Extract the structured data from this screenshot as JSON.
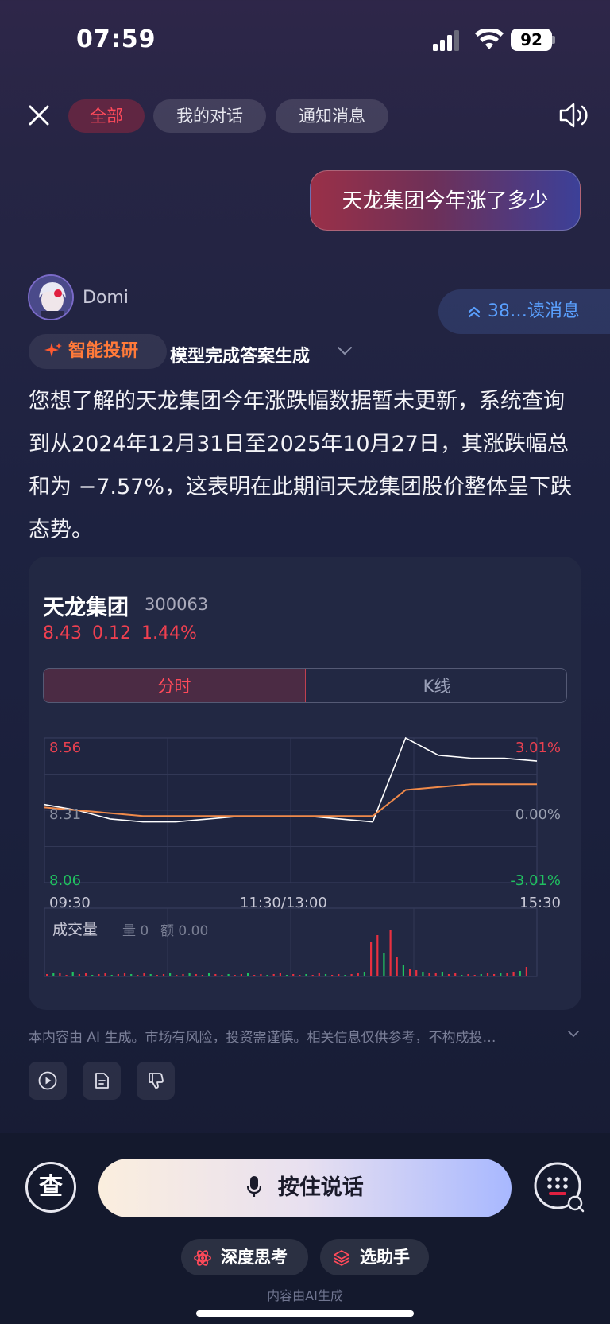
{
  "status_bar": {
    "time": "07:59",
    "battery": "92"
  },
  "header": {
    "tabs": [
      {
        "label": "全部",
        "active": true
      },
      {
        "label": "我的对话",
        "active": false
      },
      {
        "label": "通知消息",
        "active": false
      }
    ]
  },
  "conversation": {
    "user_message": "天龙集团今年涨了多少",
    "bot_name": "Domi",
    "unread_label": "38…读消息",
    "badge_label": "智能投研",
    "status_text": "模型完成答案生成",
    "answer_text": "您想了解的天龙集团今年涨跌幅数据暂未更新，系统查询到从2024年12月31日至2025年10月27日，其涨跌幅总和为 −7.57%，这表明在此期间天龙集团股价整体呈下跌态势。"
  },
  "stock_card": {
    "name": "天龙集团",
    "code": "300063",
    "quote": "8.43  0.12  1.44%",
    "tabs": [
      "分时",
      "K线"
    ],
    "chart_labels": {
      "price_high": "8.56",
      "price_mid": "8.31",
      "price_low": "8.06",
      "pct_high": "3.01%",
      "pct_mid": "0.00%",
      "pct_low": "-3.01%",
      "time_start": "09:30",
      "time_mid": "11:30/13:00",
      "time_end": "15:30",
      "volume_title": "成交量",
      "volume_qty": "量 0",
      "volume_amount": "额 0.00"
    }
  },
  "chart_data": {
    "type": "line",
    "title": "",
    "ylim": [
      8.06,
      8.56
    ],
    "x": [
      "09:30",
      "11:30/13:00",
      "15:30"
    ],
    "series": [
      {
        "values": [
          8.33,
          8.31,
          8.28,
          8.27,
          8.27,
          8.28,
          8.29,
          8.29,
          8.29,
          8.28,
          8.27,
          8.56,
          8.5,
          8.49,
          8.49,
          8.48
        ]
      },
      {
        "values": [
          8.32,
          8.31,
          8.3,
          8.29,
          8.29,
          8.29,
          8.29,
          8.29,
          8.29,
          8.29,
          8.29,
          8.38,
          8.39,
          8.4,
          8.4,
          8.4
        ]
      }
    ],
    "colors": {
      "price": "#ffffff",
      "average": "#f08a4a",
      "up": "#e83040",
      "down": "#20c060"
    }
  },
  "disclaimer": "本内容由 AI 生成。市场有风险，投资需谨慎。相关信息仅供参考，不构成投…",
  "bottom_bar": {
    "lookup_label": "查",
    "talk_label": "按住说话",
    "pills": [
      "深度思考",
      "选助手"
    ],
    "ai_note": "内容由AI生成"
  }
}
